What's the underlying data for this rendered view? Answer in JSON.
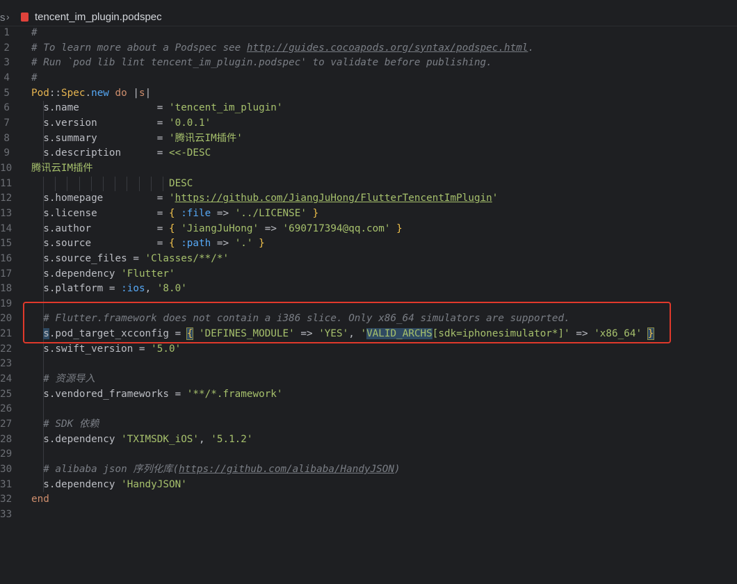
{
  "tab": {
    "prev_crumb": "s",
    "separator": "›",
    "file_name": "tencent_im_plugin.podspec",
    "file_icon_color": "#e0423b"
  },
  "colors": {
    "background": "#1e1f22",
    "comment": "#7a7e85",
    "string": "#a6c06c",
    "keyword": "#cf8e6d",
    "highlight_box": "#e0392b"
  },
  "lines": [
    {
      "n": "1",
      "tokens": [
        {
          "t": "#",
          "c": "c-comment"
        }
      ]
    },
    {
      "n": "2",
      "tokens": [
        {
          "t": "# To learn more about a Podspec see ",
          "c": "c-comment"
        },
        {
          "t": "http://guides.cocoapods.org/syntax/podspec.html",
          "c": "c-link"
        },
        {
          "t": ".",
          "c": "c-comment"
        }
      ]
    },
    {
      "n": "3",
      "tokens": [
        {
          "t": "# Run `pod lib lint tencent_im_plugin.podspec' to validate before publishing.",
          "c": "c-comment"
        }
      ]
    },
    {
      "n": "4",
      "tokens": [
        {
          "t": "#",
          "c": "c-comment"
        }
      ]
    },
    {
      "n": "5",
      "tokens": [
        {
          "t": "Pod",
          "c": "c-const"
        },
        {
          "t": "::",
          "c": "c-punct"
        },
        {
          "t": "Spec",
          "c": "c-const"
        },
        {
          "t": ".",
          "c": "c-punct"
        },
        {
          "t": "new",
          "c": "c-method"
        },
        {
          "t": " ",
          "c": "c-punct"
        },
        {
          "t": "do",
          "c": "c-kw"
        },
        {
          "t": " |",
          "c": "c-punct"
        },
        {
          "t": "s",
          "c": "c-var"
        },
        {
          "t": "|",
          "c": "c-punct"
        }
      ]
    },
    {
      "n": "6",
      "tokens": [
        {
          "t": "  s.name             ",
          "c": "c-ident"
        },
        {
          "t": "= ",
          "c": "c-op"
        },
        {
          "t": "'tencent_im_plugin'",
          "c": "c-str"
        }
      ]
    },
    {
      "n": "7",
      "tokens": [
        {
          "t": "  s.version          ",
          "c": "c-ident"
        },
        {
          "t": "= ",
          "c": "c-op"
        },
        {
          "t": "'0.0.1'",
          "c": "c-str"
        }
      ]
    },
    {
      "n": "8",
      "tokens": [
        {
          "t": "  s.summary          ",
          "c": "c-ident"
        },
        {
          "t": "= ",
          "c": "c-op"
        },
        {
          "t": "'腾讯云IM插件'",
          "c": "c-str"
        }
      ]
    },
    {
      "n": "9",
      "tokens": [
        {
          "t": "  s.description      ",
          "c": "c-ident"
        },
        {
          "t": "= ",
          "c": "c-op"
        },
        {
          "t": "<<-DESC",
          "c": "c-heredoc"
        }
      ]
    },
    {
      "n": "10",
      "tokens": [
        {
          "t": "腾讯云IM插件",
          "c": "c-heredoc"
        }
      ]
    },
    {
      "n": "11",
      "tokens": [
        {
          "t": "                       DESC",
          "c": "c-heredoc"
        }
      ]
    },
    {
      "n": "12",
      "tokens": [
        {
          "t": "  s.homepage         ",
          "c": "c-ident"
        },
        {
          "t": "= ",
          "c": "c-op"
        },
        {
          "t": "'",
          "c": "c-str"
        },
        {
          "t": "https://github.com/JiangJuHong/FlutterTencentImPlugin",
          "c": "c-str",
          "u": true
        },
        {
          "t": "'",
          "c": "c-str"
        }
      ]
    },
    {
      "n": "13",
      "tokens": [
        {
          "t": "  s.license          ",
          "c": "c-ident"
        },
        {
          "t": "= ",
          "c": "c-op"
        },
        {
          "t": "{ ",
          "c": "c-brace"
        },
        {
          "t": ":file",
          "c": "c-sym"
        },
        {
          "t": " => ",
          "c": "c-op"
        },
        {
          "t": "'../LICENSE'",
          "c": "c-str"
        },
        {
          "t": " }",
          "c": "c-brace"
        }
      ]
    },
    {
      "n": "14",
      "tokens": [
        {
          "t": "  s.author           ",
          "c": "c-ident"
        },
        {
          "t": "= ",
          "c": "c-op"
        },
        {
          "t": "{ ",
          "c": "c-brace"
        },
        {
          "t": "'JiangJuHong'",
          "c": "c-str"
        },
        {
          "t": " => ",
          "c": "c-op"
        },
        {
          "t": "'690717394@qq.com'",
          "c": "c-str"
        },
        {
          "t": " }",
          "c": "c-brace"
        }
      ]
    },
    {
      "n": "15",
      "tokens": [
        {
          "t": "  s.source           ",
          "c": "c-ident"
        },
        {
          "t": "= ",
          "c": "c-op"
        },
        {
          "t": "{ ",
          "c": "c-brace"
        },
        {
          "t": ":path",
          "c": "c-sym"
        },
        {
          "t": " => ",
          "c": "c-op"
        },
        {
          "t": "'.'",
          "c": "c-str"
        },
        {
          "t": " }",
          "c": "c-brace"
        }
      ]
    },
    {
      "n": "16",
      "tokens": [
        {
          "t": "  s.source_files = ",
          "c": "c-ident"
        },
        {
          "t": "'Classes/**/*'",
          "c": "c-str"
        }
      ]
    },
    {
      "n": "17",
      "tokens": [
        {
          "t": "  s.dependency ",
          "c": "c-ident"
        },
        {
          "t": "'Flutter'",
          "c": "c-str"
        }
      ]
    },
    {
      "n": "18",
      "tokens": [
        {
          "t": "  s.platform = ",
          "c": "c-ident"
        },
        {
          "t": ":ios",
          "c": "c-sym"
        },
        {
          "t": ", ",
          "c": "c-op"
        },
        {
          "t": "'8.0'",
          "c": "c-str"
        }
      ]
    },
    {
      "n": "19",
      "tokens": []
    },
    {
      "n": "20",
      "tokens": [
        {
          "t": "  ",
          "c": "c-ident"
        },
        {
          "t": "# Flutter.framework does not contain a i386 slice. Only x86_64 simulators are supported.",
          "c": "c-comment"
        }
      ]
    },
    {
      "n": "21",
      "tokens": [
        {
          "t": "  ",
          "c": "c-ident"
        },
        {
          "t": "s",
          "c": "c-ident sel"
        },
        {
          "t": ".pod_target_xcconfig ",
          "c": "c-ident"
        },
        {
          "t": "= ",
          "c": "c-op"
        },
        {
          "t": "{",
          "c": "c-brace sel-brace"
        },
        {
          "t": " ",
          "c": "c-op"
        },
        {
          "t": "'DEFINES_MODULE'",
          "c": "c-str"
        },
        {
          "t": " => ",
          "c": "c-op"
        },
        {
          "t": "'YES'",
          "c": "c-str"
        },
        {
          "t": ", ",
          "c": "c-op"
        },
        {
          "t": "'",
          "c": "c-str"
        },
        {
          "t": "VALID_ARCHS",
          "c": "c-str sel"
        },
        {
          "t": "[sdk=iphonesimulator*]'",
          "c": "c-str"
        },
        {
          "t": " => ",
          "c": "c-op"
        },
        {
          "t": "'x86_64'",
          "c": "c-str"
        },
        {
          "t": " ",
          "c": "c-op"
        },
        {
          "t": "}",
          "c": "c-brace sel-brace"
        }
      ]
    },
    {
      "n": "22",
      "tokens": [
        {
          "t": "  s.swift_version = ",
          "c": "c-ident"
        },
        {
          "t": "'5.0'",
          "c": "c-str"
        }
      ]
    },
    {
      "n": "23",
      "tokens": []
    },
    {
      "n": "24",
      "tokens": [
        {
          "t": "  ",
          "c": "c-ident"
        },
        {
          "t": "# 资源导入",
          "c": "c-comment"
        }
      ]
    },
    {
      "n": "25",
      "tokens": [
        {
          "t": "  s.vendored_frameworks = ",
          "c": "c-ident"
        },
        {
          "t": "'**/*.framework'",
          "c": "c-str"
        }
      ]
    },
    {
      "n": "26",
      "tokens": []
    },
    {
      "n": "27",
      "tokens": [
        {
          "t": "  ",
          "c": "c-ident"
        },
        {
          "t": "# SDK 依赖",
          "c": "c-comment"
        }
      ]
    },
    {
      "n": "28",
      "tokens": [
        {
          "t": "  s.dependency ",
          "c": "c-ident"
        },
        {
          "t": "'TXIMSDK_iOS'",
          "c": "c-str"
        },
        {
          "t": ", ",
          "c": "c-op"
        },
        {
          "t": "'5.1.2'",
          "c": "c-str"
        }
      ]
    },
    {
      "n": "29",
      "tokens": []
    },
    {
      "n": "30",
      "tokens": [
        {
          "t": "  ",
          "c": "c-ident"
        },
        {
          "t": "# alibaba json 序列化库(",
          "c": "c-comment"
        },
        {
          "t": "https://github.com/alibaba/HandyJSON",
          "c": "c-link"
        },
        {
          "t": ")",
          "c": "c-comment"
        }
      ]
    },
    {
      "n": "31",
      "tokens": [
        {
          "t": "  s.dependency ",
          "c": "c-ident"
        },
        {
          "t": "'HandyJSON'",
          "c": "c-str"
        }
      ]
    },
    {
      "n": "32",
      "tokens": [
        {
          "t": "end",
          "c": "c-kw"
        }
      ]
    },
    {
      "n": "33",
      "tokens": []
    }
  ]
}
